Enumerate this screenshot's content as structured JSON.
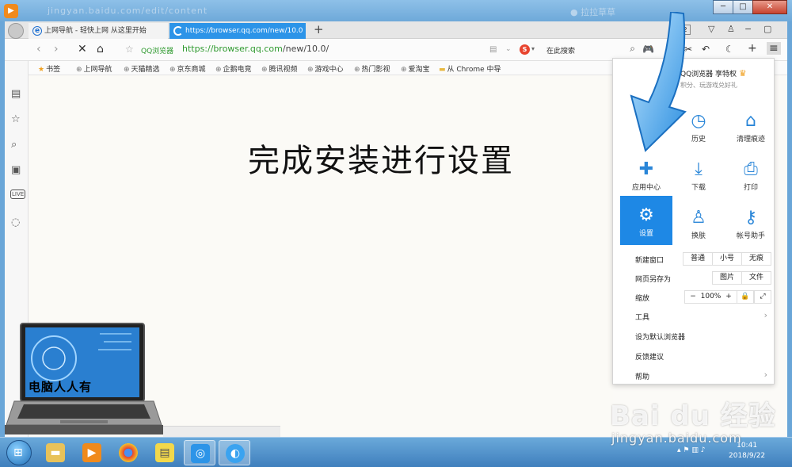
{
  "window": {
    "ghost_title": "jingyan.baidu.com/edit/content",
    "ghost_right": "● 拉拉草草",
    "minimize": "─",
    "maximize": "□",
    "close": "✕"
  },
  "tabs": [
    {
      "title": "上网导航 - 轻快上网 从这里开始",
      "icon": "ie-e-icon"
    },
    {
      "title": "https://browser.qq.com/new/10.0",
      "icon": "loading-icon"
    }
  ],
  "tab_add": "+",
  "tab_counter": "2",
  "navbar": {
    "qq_label": "QQ浏览器",
    "url_host": "https://browser.qq.com",
    "url_path": "/new/10.0/",
    "search_placeholder": "在此搜索",
    "search_engine": "S"
  },
  "bookmarks": [
    {
      "label": "书签",
      "icon": "star-icon"
    },
    {
      "label": "上网导航",
      "icon": "globe-icon"
    },
    {
      "label": "天猫精选",
      "icon": "globe-icon"
    },
    {
      "label": "京东商城",
      "icon": "globe-icon"
    },
    {
      "label": "企鹅电竞",
      "icon": "globe-icon"
    },
    {
      "label": "腾讯视频",
      "icon": "globe-icon"
    },
    {
      "label": "游戏中心",
      "icon": "globe-icon"
    },
    {
      "label": "热门影视",
      "icon": "globe-icon"
    },
    {
      "label": "爱淘宝",
      "icon": "globe-icon"
    },
    {
      "label": "从 Chrome 中导",
      "icon": "folder-icon"
    }
  ],
  "content": {
    "headline": "完成安装进行设置"
  },
  "menu": {
    "header": "QQ浏览器 享特权",
    "sub": "积分、玩游戏兑好礼",
    "grid": [
      {
        "label": "历史",
        "icon": "clock-icon"
      },
      {
        "label": "清理痕迹",
        "icon": "broom-icon"
      },
      {
        "label": "应用中心",
        "icon": "puzzle-icon"
      },
      {
        "label": "下载",
        "icon": "download-icon"
      },
      {
        "label": "打印",
        "icon": "printer-icon"
      },
      {
        "label": "设置",
        "icon": "gear-icon"
      },
      {
        "label": "换肤",
        "icon": "shirt-icon"
      },
      {
        "label": "帐号助手",
        "icon": "key-icon"
      }
    ],
    "new_window": {
      "label": "新建窗口",
      "options": [
        "普通",
        "小号",
        "无痕"
      ]
    },
    "save_page": {
      "label": "网页另存为",
      "options": [
        "图片",
        "文件"
      ]
    },
    "zoom": {
      "label": "缩放",
      "minus": "−",
      "value": "100%",
      "plus": "+"
    },
    "items": [
      "工具",
      "设为默认浏览器",
      "反馈建议",
      "帮助"
    ]
  },
  "overlay": {
    "laptop_label": "电脑人人有"
  },
  "taskbar": {
    "time": "10:41",
    "date": "2018/9/22"
  },
  "watermark": {
    "logo": "Bai du 经验",
    "url": "jingyan.baidu.com"
  },
  "colors": {
    "accent": "#1e88e5",
    "tab_active": "#2c94e8",
    "url_green": "#2f9a2f"
  }
}
